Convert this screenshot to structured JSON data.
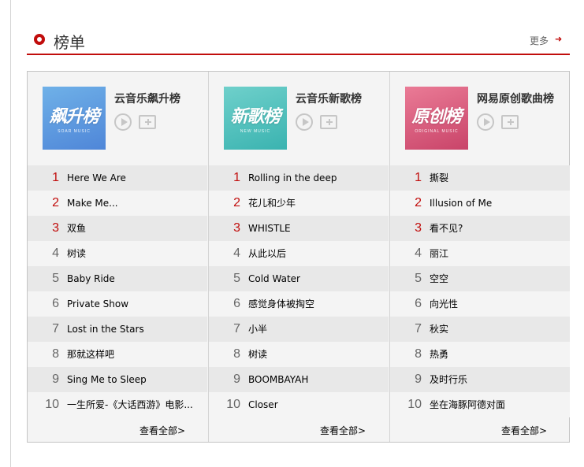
{
  "header": {
    "title": "榜单",
    "more_label": "更多",
    "more_arrow": "➜"
  },
  "boards": [
    {
      "name": "云音乐飙升榜",
      "cover_text": "飙升榜",
      "cover_subtext": "SOAR MUSIC",
      "view_all": "查看全部>",
      "songs": [
        {
          "rank": "1",
          "title": "Here We Are"
        },
        {
          "rank": "2",
          "title": "Make Me..."
        },
        {
          "rank": "3",
          "title": "双鱼"
        },
        {
          "rank": "4",
          "title": "树读"
        },
        {
          "rank": "5",
          "title": "Baby Ride"
        },
        {
          "rank": "6",
          "title": "Private Show"
        },
        {
          "rank": "7",
          "title": "Lost in the Stars"
        },
        {
          "rank": "8",
          "title": "那就这样吧"
        },
        {
          "rank": "9",
          "title": "Sing Me to Sleep"
        },
        {
          "rank": "10",
          "title": "一生所爱-《大话西游》电影..."
        }
      ]
    },
    {
      "name": "云音乐新歌榜",
      "cover_text": "新歌榜",
      "cover_subtext": "NEW MUSIC",
      "view_all": "查看全部>",
      "songs": [
        {
          "rank": "1",
          "title": "Rolling in the deep"
        },
        {
          "rank": "2",
          "title": "花儿和少年"
        },
        {
          "rank": "3",
          "title": "WHISTLE"
        },
        {
          "rank": "4",
          "title": "从此以后"
        },
        {
          "rank": "5",
          "title": "Cold Water"
        },
        {
          "rank": "6",
          "title": "感觉身体被掏空"
        },
        {
          "rank": "7",
          "title": "小半"
        },
        {
          "rank": "8",
          "title": "树读"
        },
        {
          "rank": "9",
          "title": "BOOMBAYAH"
        },
        {
          "rank": "10",
          "title": "Closer"
        }
      ]
    },
    {
      "name": "网易原创歌曲榜",
      "cover_text": "原创榜",
      "cover_subtext": "ORIGINAL MUSIC",
      "view_all": "查看全部>",
      "songs": [
        {
          "rank": "1",
          "title": "撕裂"
        },
        {
          "rank": "2",
          "title": "Illusion of Me"
        },
        {
          "rank": "3",
          "title": "看不见?"
        },
        {
          "rank": "4",
          "title": "丽江"
        },
        {
          "rank": "5",
          "title": "空空"
        },
        {
          "rank": "6",
          "title": "向光性"
        },
        {
          "rank": "7",
          "title": "秋实"
        },
        {
          "rank": "8",
          "title": "热勇"
        },
        {
          "rank": "9",
          "title": "及时行乐"
        },
        {
          "rank": "10",
          "title": "坐在海豚阿德对面"
        }
      ]
    }
  ],
  "colors": {
    "accent": "#c10d0c",
    "cover_1": "#5a97dd",
    "cover_2": "#48bfbb",
    "cover_3": "#d6587a"
  },
  "icons": {
    "header": "circle-ring-icon",
    "play": "play-circle-icon",
    "add": "add-folder-icon"
  }
}
